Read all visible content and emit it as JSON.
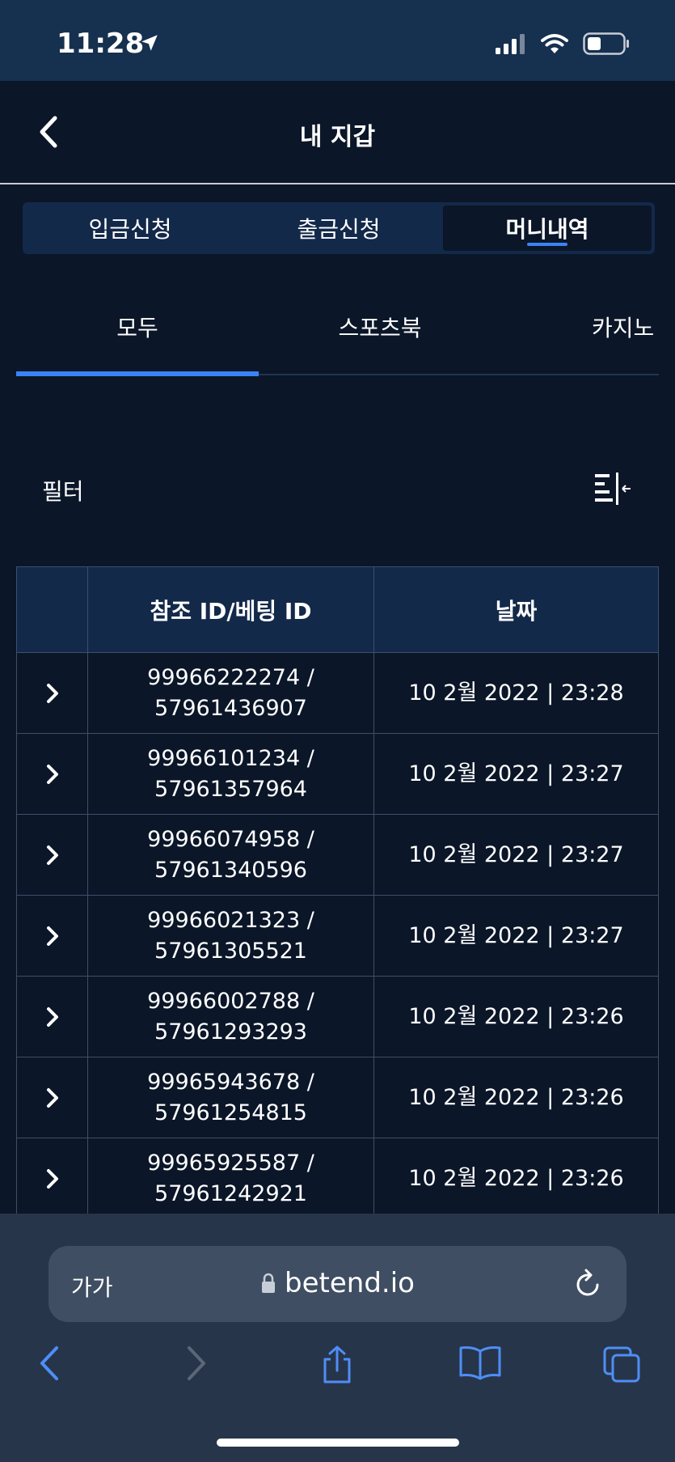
{
  "status": {
    "time": "11:28"
  },
  "header": {
    "title": "내 지갑"
  },
  "segments": [
    {
      "label": "입금신청"
    },
    {
      "label": "출금신청"
    },
    {
      "label": "머니내역"
    }
  ],
  "tabs": [
    {
      "label": "모두"
    },
    {
      "label": "스포츠북"
    },
    {
      "label": "카지노"
    }
  ],
  "filter": {
    "label": "필터"
  },
  "table": {
    "headers": [
      "",
      "참조 ID/베팅 ID",
      "날짜"
    ],
    "rows": [
      {
        "ref": "99966222274 /",
        "bet": "57961436907",
        "date": "10 2월 2022 | 23:28"
      },
      {
        "ref": "99966101234 /",
        "bet": "57961357964",
        "date": "10 2월 2022 | 23:27"
      },
      {
        "ref": "99966074958 /",
        "bet": "57961340596",
        "date": "10 2월 2022 | 23:27"
      },
      {
        "ref": "99966021323 /",
        "bet": "57961305521",
        "date": "10 2월 2022 | 23:27"
      },
      {
        "ref": "99966002788 /",
        "bet": "57961293293",
        "date": "10 2월 2022 | 23:26"
      },
      {
        "ref": "99965943678 /",
        "bet": "57961254815",
        "date": "10 2월 2022 | 23:26"
      },
      {
        "ref": "99965925587 /",
        "bet": "57961242921",
        "date": "10 2월 2022 | 23:26"
      }
    ]
  },
  "browser": {
    "aa_label": "가가",
    "url": "betend.io"
  },
  "colors": {
    "accent": "#3b82f6",
    "background": "#0b1628",
    "header_bg": "#13294a"
  }
}
